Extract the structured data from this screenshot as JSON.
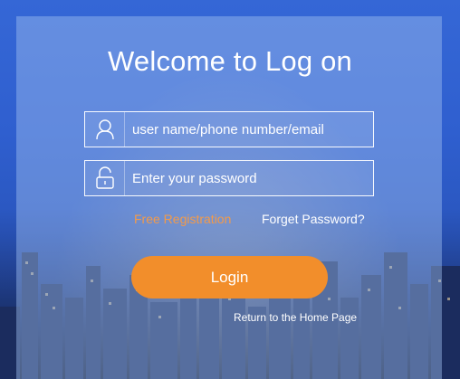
{
  "title": "Welcome to Log on",
  "username": {
    "placeholder": "user name/phone number/email",
    "icon": "user-icon"
  },
  "password": {
    "placeholder": "Enter your password",
    "icon": "unlock-icon"
  },
  "links": {
    "register": "Free Registration",
    "forgot": "Forget Password?",
    "home": "Return to the Home Page"
  },
  "login_button": "Login",
  "colors": {
    "accent": "#f28e2b",
    "register_link": "#f29a4a",
    "background": "#2f5fcf",
    "text": "#ffffff"
  }
}
